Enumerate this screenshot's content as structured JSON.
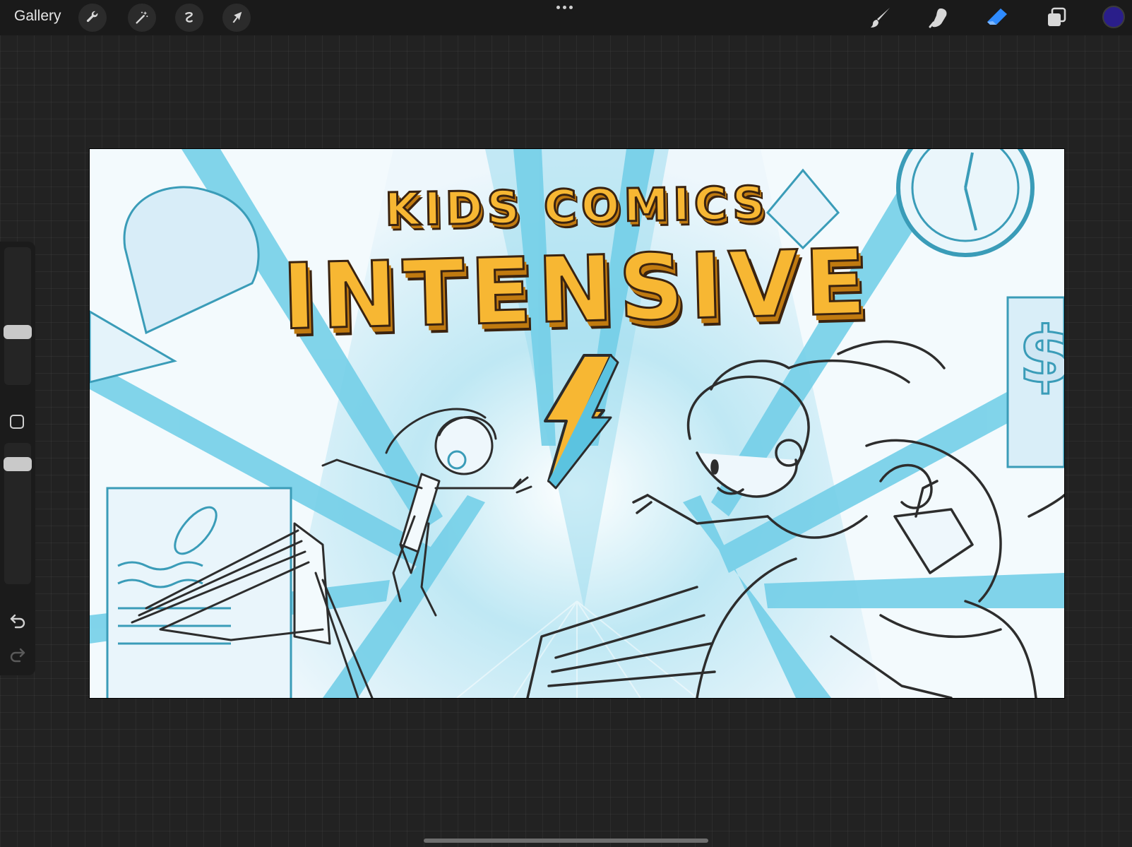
{
  "topbar": {
    "gallery_label": "Gallery",
    "left_tools": [
      {
        "name": "actions",
        "icon": "wrench-icon"
      },
      {
        "name": "adjustments",
        "icon": "magic-wand-icon"
      },
      {
        "name": "selection",
        "icon": "selection-icon"
      },
      {
        "name": "transform",
        "icon": "arrow-cursor-icon"
      }
    ],
    "more_icon": "more-dots-icon",
    "right_tools": [
      {
        "name": "brush",
        "icon": "brush-icon",
        "active": false
      },
      {
        "name": "smudge",
        "icon": "smudge-icon",
        "active": false
      },
      {
        "name": "eraser",
        "icon": "eraser-icon",
        "active": true
      },
      {
        "name": "layers",
        "icon": "layers-icon",
        "active": false
      }
    ],
    "current_color": "#2a1e8a",
    "active_tool_color": "#2f8bff"
  },
  "sidebar": {
    "brush_size_slider": {
      "level": 0.35
    },
    "opacity_slider": {
      "level": 0.05
    },
    "modify_button_icon": "square-icon",
    "undo_icon": "undo-icon",
    "redo_icon": "redo-icon"
  },
  "canvas": {
    "title_line1": "KIDS COMICS",
    "title_line2": "INTENSIVE",
    "accent_color": "#f7b733",
    "line_color": "#5bc3e0"
  }
}
